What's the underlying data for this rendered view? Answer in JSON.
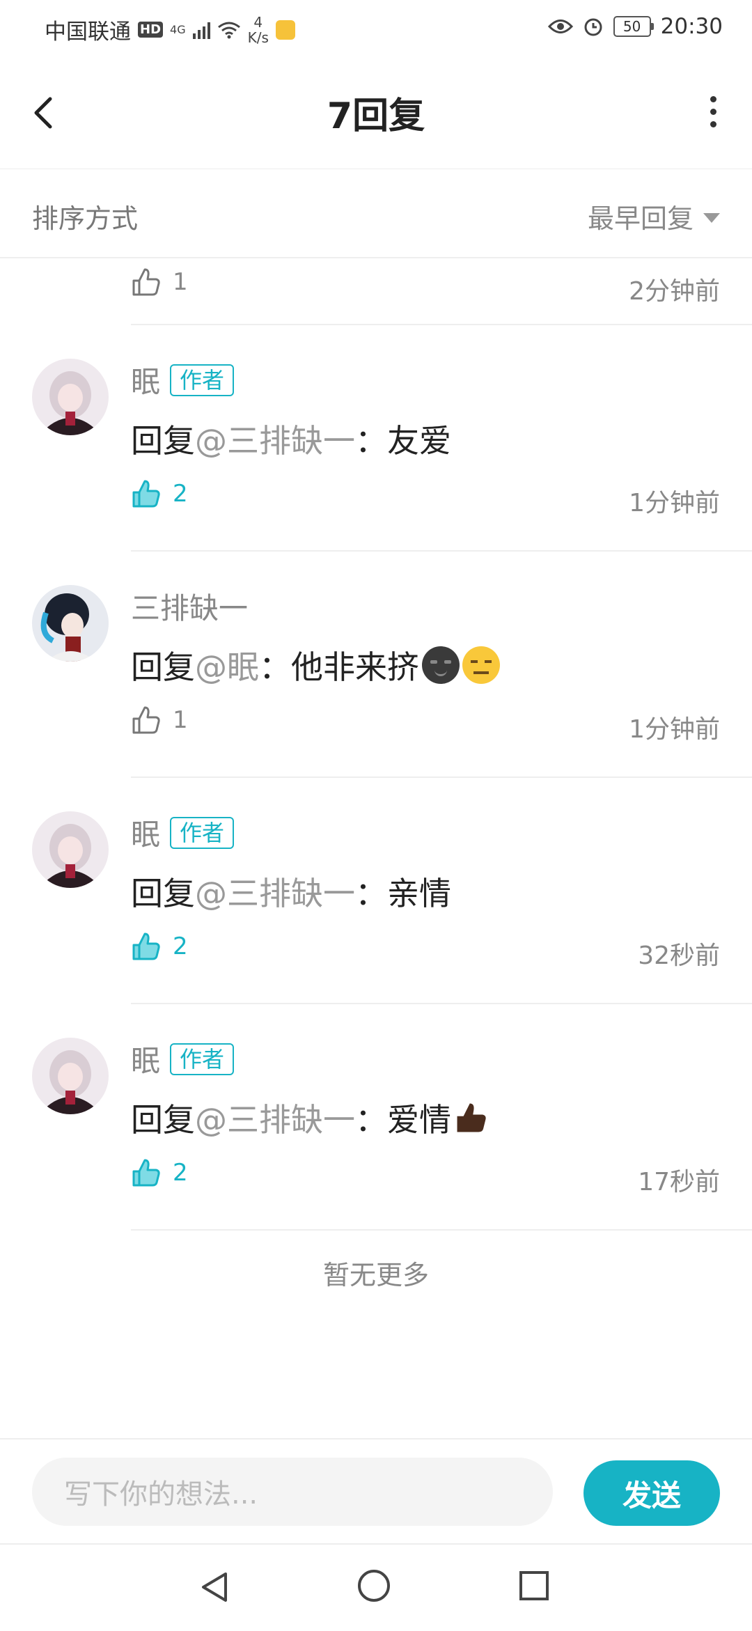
{
  "status_bar": {
    "carrier": "中国联通",
    "hd": "HD",
    "net_gen": "4G",
    "net_speed_value": "4",
    "net_speed_unit": "K/s",
    "battery": "50",
    "time": "20:30"
  },
  "header": {
    "title": "7回复"
  },
  "sort": {
    "label": "排序方式",
    "selected": "最早回复"
  },
  "partial_comment": {
    "likes": "1",
    "time": "2分钟前",
    "liked": false
  },
  "comments": [
    {
      "name": "眠",
      "badge": "作者",
      "reply_prefix": "回复",
      "reply_to": "@三排缺一",
      "text": "：友爱",
      "likes": "2",
      "liked": true,
      "time": "1分钟前"
    },
    {
      "name": "三排缺一",
      "badge": "",
      "reply_prefix": "回复",
      "reply_to": "@眠",
      "text": "：他非来挤",
      "likes": "1",
      "liked": false,
      "time": "1分钟前"
    },
    {
      "name": "眠",
      "badge": "作者",
      "reply_prefix": "回复",
      "reply_to": "@三排缺一",
      "text": "：亲情",
      "likes": "2",
      "liked": true,
      "time": "32秒前"
    },
    {
      "name": "眠",
      "badge": "作者",
      "reply_prefix": "回复",
      "reply_to": "@三排缺一",
      "text": "：爱情",
      "likes": "2",
      "liked": true,
      "time": "17秒前"
    }
  ],
  "footer_text": "暂无更多",
  "input": {
    "placeholder": "写下你的想法..."
  },
  "send_label": "发送",
  "colors": {
    "accent": "#17b3c5",
    "muted_text": "#888888"
  }
}
